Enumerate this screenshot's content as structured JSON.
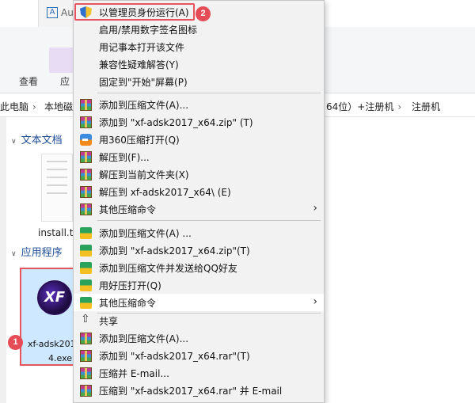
{
  "window": {
    "title_fragment": "Aut",
    "ribbon_tabs": [
      "查看",
      "应"
    ]
  },
  "breadcrumb": [
    "此电脑",
    "本地磁",
    "64位）+注册机",
    "注册机"
  ],
  "groups": {
    "text_docs": "文本文档",
    "applications": "应用程序"
  },
  "files": {
    "txt_name": "install.t",
    "exe_name_line1": "xf-adsk201",
    "exe_name_line2": "4.exe",
    "exe_icon_text": "XF"
  },
  "badges": {
    "step1": "1",
    "step2": "2"
  },
  "context_menu": {
    "items": [
      {
        "label": "以管理员身份运行(A)",
        "icon": "uac-shield-icon"
      },
      {
        "label": "启用/禁用数字签名图标",
        "icon": ""
      },
      {
        "label": "用记事本打开该文件",
        "icon": ""
      },
      {
        "label": "兼容性疑难解答(Y)",
        "icon": ""
      },
      {
        "label": "固定到\"开始\"屏幕(P)",
        "icon": ""
      },
      {
        "label": "添加到压缩文件(A)...",
        "icon": "winrar-icon"
      },
      {
        "label": "添加到 \"xf-adsk2017_x64.zip\" (T)",
        "icon": "winrar-icon"
      },
      {
        "label": "用360压缩打开(Q)",
        "icon": "360zip-icon"
      },
      {
        "label": "解压到(F)...",
        "icon": "winrar-icon"
      },
      {
        "label": "解压到当前文件夹(X)",
        "icon": "winrar-icon"
      },
      {
        "label": "解压到 xf-adsk2017_x64\\ (E)",
        "icon": "winrar-icon"
      },
      {
        "label": "其他压缩命令",
        "icon": "winrar-icon"
      },
      {
        "label": "添加到压缩文件(A) ...",
        "icon": "haozip-icon"
      },
      {
        "label": "添加到 \"xf-adsk2017_x64.zip\"(T)",
        "icon": "haozip-icon"
      },
      {
        "label": "添加到压缩文件并发送给QQ好友",
        "icon": "haozip-icon"
      },
      {
        "label": "用好压打开(Q)",
        "icon": "haozip-icon"
      },
      {
        "label": "其他压缩命令",
        "icon": "haozip-icon"
      },
      {
        "label": "共享",
        "icon": "share-icon"
      },
      {
        "label": "添加到压缩文件(A)...",
        "icon": "winrar-icon"
      },
      {
        "label": "添加到 \"xf-adsk2017_x64.rar\"(T)",
        "icon": "winrar-icon"
      },
      {
        "label": "压缩并 E-mail...",
        "icon": "winrar-icon"
      },
      {
        "label": "压缩到 \"xf-adsk2017_x64.rar\" 并 E-mail",
        "icon": "winrar-icon"
      }
    ]
  },
  "colors": {
    "annotation_red": "#e8545e",
    "selection_blue": "#cde8ff",
    "menu_bg": "#f2f2f2"
  }
}
